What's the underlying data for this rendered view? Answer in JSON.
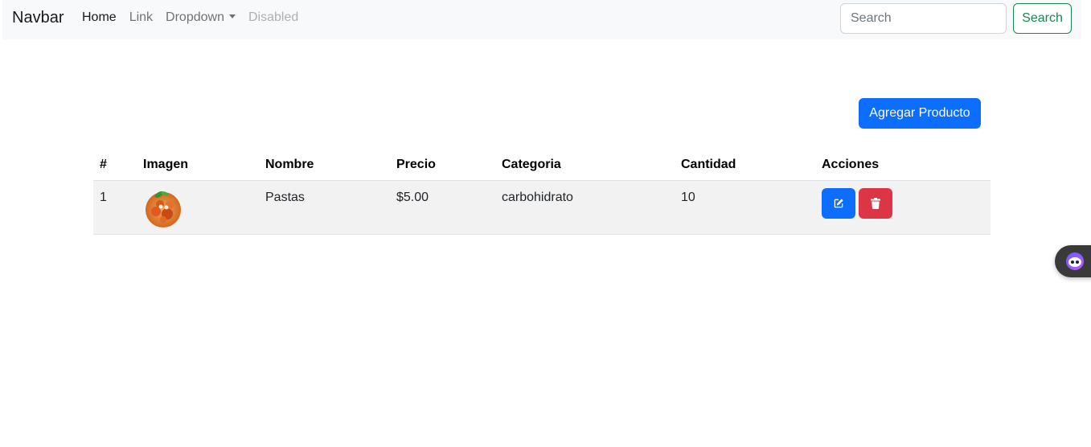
{
  "navbar": {
    "brand": "Navbar",
    "links": [
      {
        "label": "Home",
        "state": "active"
      },
      {
        "label": "Link",
        "state": "normal"
      },
      {
        "label": "Dropdown",
        "state": "dropdown"
      },
      {
        "label": "Disabled",
        "state": "disabled"
      }
    ],
    "search_placeholder": "Search",
    "search_button": "Search"
  },
  "main": {
    "add_button": "Agregar Producto",
    "table": {
      "headers": [
        "#",
        "Imagen",
        "Nombre",
        "Precio",
        "Categoria",
        "Cantidad",
        "Acciones"
      ],
      "rows": [
        {
          "num": "1",
          "image_icon": "pasta-image",
          "name": "Pastas",
          "price": "$5.00",
          "category": "carbohidrato",
          "quantity": "10"
        }
      ]
    }
  },
  "colors": {
    "primary": "#0d6efd",
    "danger": "#dc3545",
    "success": "#198754",
    "navbar_bg": "#f8f9fa",
    "row_bg": "#f2f2f2"
  },
  "icons": {
    "edit": "edit-icon",
    "delete": "trash-icon",
    "widget": "assistant-face-icon"
  }
}
